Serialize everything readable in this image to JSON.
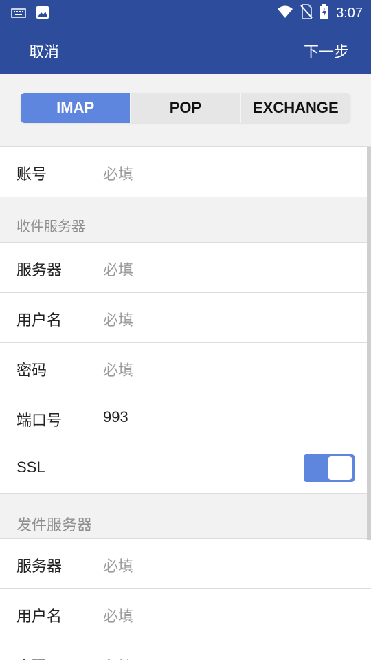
{
  "status": {
    "time": "3:07"
  },
  "header": {
    "cancel": "取消",
    "next": "下一步"
  },
  "tabs": [
    {
      "label": "IMAP",
      "active": true
    },
    {
      "label": "POP"
    },
    {
      "label": "EXCHANGE"
    }
  ],
  "account": {
    "label": "账号",
    "placeholder": "必填"
  },
  "incoming": {
    "title": "收件服务器",
    "server": {
      "label": "服务器",
      "placeholder": "必填"
    },
    "username": {
      "label": "用户名",
      "placeholder": "必填"
    },
    "password": {
      "label": "密码",
      "placeholder": "必填"
    },
    "port": {
      "label": "端口号",
      "value": "993"
    },
    "ssl": {
      "label": "SSL",
      "enabled": true
    }
  },
  "outgoing": {
    "title": "发件服务器",
    "server": {
      "label": "服务器",
      "placeholder": "必填"
    },
    "username": {
      "label": "用户名",
      "placeholder": "必填"
    },
    "password": {
      "label": "密码",
      "placeholder": "必填"
    }
  },
  "colors": {
    "primary": "#2d4d9c",
    "accent": "#5f86de"
  }
}
